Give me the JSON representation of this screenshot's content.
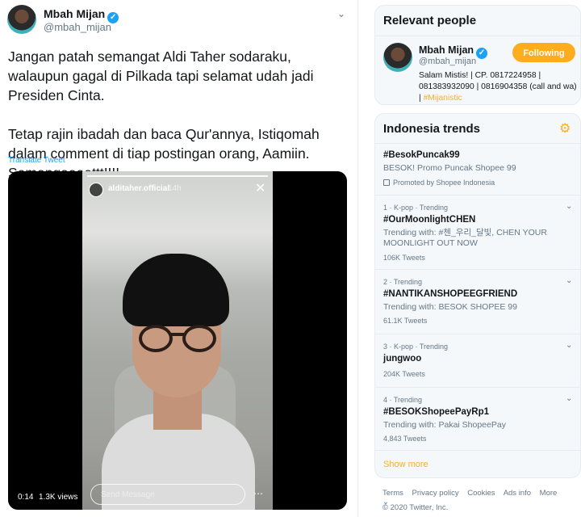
{
  "tweet": {
    "author_name": "Mbah Mijan",
    "author_handle": "@mbah_mijan",
    "text": "Jangan patah semangat Aldi Taher sodaraku, walaupun gagal di Pilkada tapi selamat udah jadi Presiden Cinta.\n\nTetap rajin ibadah dan baca Qur'annya, Istiqomah dalam comment di tiap postingan orang, Aamiin. Semangaaaattt!!!!",
    "translate_label": "Translate Tweet",
    "video": {
      "story_user": "alditaher.official",
      "story_time": "14h",
      "send_message_placeholder": "Send Message",
      "time": "0:14",
      "views": "1.3K views"
    }
  },
  "relevant": {
    "title": "Relevant people",
    "name": "Mbah Mijan",
    "handle": "@mbah_mijan",
    "follow_label": "Following",
    "bio": "Salam Mistis! | CP. 0817224958 | 081383932090 | 0816904358 (call and wa) |",
    "bio_hashtag": "#Mijanistic"
  },
  "trends": {
    "title": "Indonesia trends",
    "items": [
      {
        "meta": "",
        "name": "#BesokPuncak99",
        "desc": "BESOK! Promo Puncak Shopee 99",
        "count": "Promoted by Shopee Indonesia"
      },
      {
        "meta": "1 · K-pop · Trending",
        "name": "#OurMoonlightCHEN",
        "desc": "Trending with: #첸_우리_달빛, CHEN YOUR MOONLIGHT OUT NOW",
        "count": "106K Tweets"
      },
      {
        "meta": "2 · Trending",
        "name": "#NANTIKANSHOPEEGFRIEND",
        "desc": "Trending with: BESOK SHOPEE 99",
        "count": "61.1K Tweets"
      },
      {
        "meta": "3 · K-pop · Trending",
        "name": "jungwoo",
        "desc": "",
        "count": "204K Tweets"
      },
      {
        "meta": "4 · Trending",
        "name": "#BESOKShopeePayRp1",
        "desc": "Trending with: Pakai ShopeePay",
        "count": "4,843 Tweets"
      }
    ],
    "show_more": "Show more"
  },
  "footer": {
    "links": [
      "Terms",
      "Privacy policy",
      "Cookies",
      "Ads info",
      "More"
    ],
    "copyright": "© 2020 Twitter, Inc."
  },
  "colors": {
    "accent": "#ffad1f",
    "verified": "#1da1f2",
    "secondary_text": "#657786"
  }
}
